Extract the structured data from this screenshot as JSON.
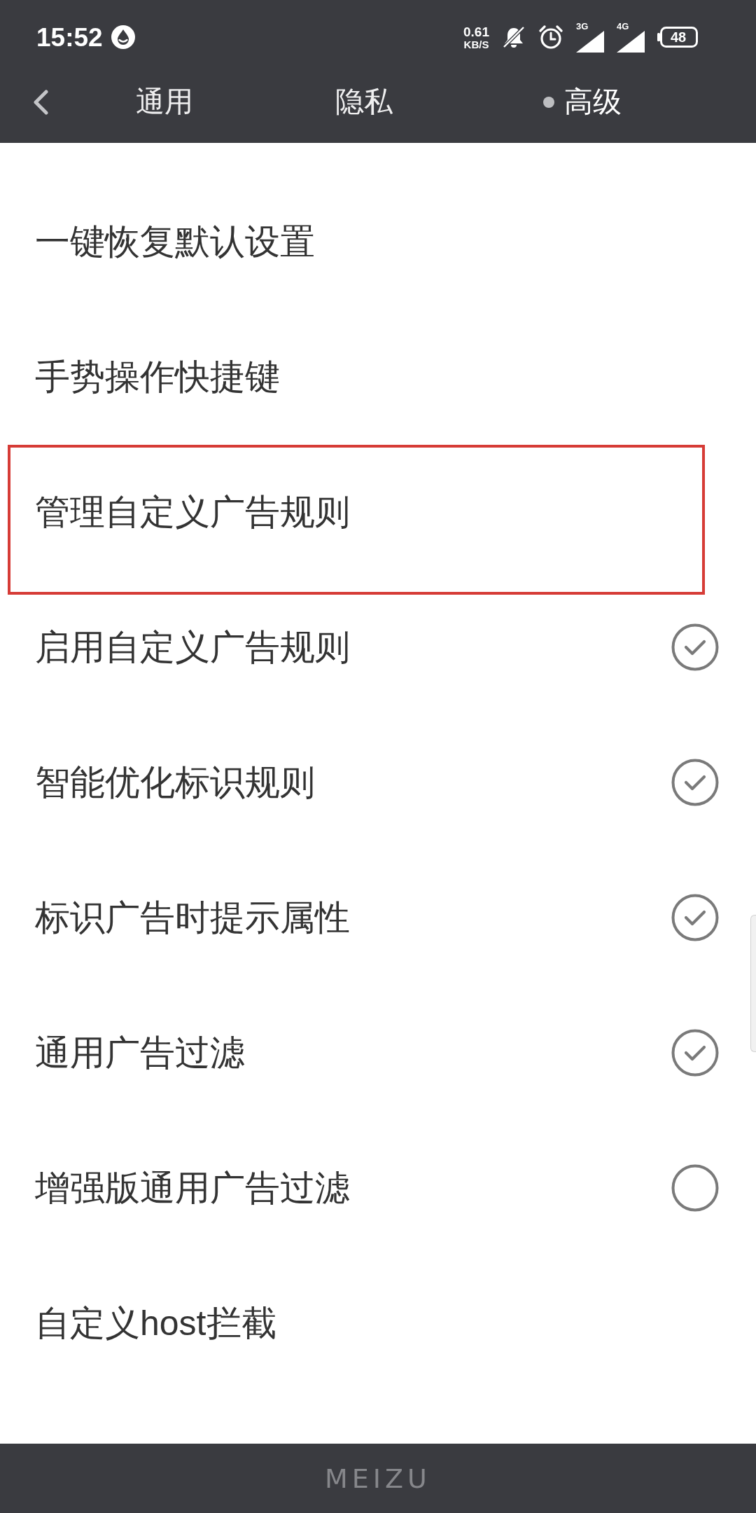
{
  "status_bar": {
    "time": "15:52",
    "net_speed": {
      "value": "0.61",
      "unit": "KB/S"
    },
    "signals": [
      {
        "label": "3G"
      },
      {
        "label": "4G"
      }
    ],
    "battery": "48"
  },
  "nav": {
    "tabs": [
      {
        "label": "通用",
        "selected": false
      },
      {
        "label": "隐私",
        "selected": false
      },
      {
        "label": "高级",
        "selected": true
      }
    ]
  },
  "items": [
    {
      "label": "一键恢复默认设置",
      "kind": "action",
      "highlighted": false
    },
    {
      "label": "手势操作快捷键",
      "kind": "action",
      "highlighted": false
    },
    {
      "label": "管理自定义广告规则",
      "kind": "action",
      "highlighted": true
    },
    {
      "label": "启用自定义广告规则",
      "kind": "check",
      "checked": true,
      "highlighted": false
    },
    {
      "label": "智能优化标识规则",
      "kind": "check",
      "checked": true,
      "highlighted": false
    },
    {
      "label": "标识广告时提示属性",
      "kind": "check",
      "checked": true,
      "highlighted": false
    },
    {
      "label": "通用广告过滤",
      "kind": "check",
      "checked": true,
      "highlighted": false
    },
    {
      "label": "增强版通用广告过滤",
      "kind": "check",
      "checked": false,
      "highlighted": false
    },
    {
      "label": "自定义host拦截",
      "kind": "action",
      "highlighted": false
    }
  ],
  "bottom_bar": {
    "brand": "MEIZU"
  }
}
